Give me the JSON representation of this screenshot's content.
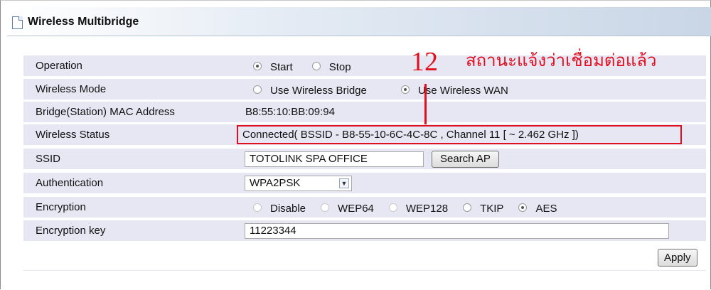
{
  "panel": {
    "title": "Wireless Multibridge"
  },
  "rows": {
    "operation": {
      "label": "Operation",
      "options": [
        "Start",
        "Stop"
      ],
      "selected": "Start"
    },
    "wireless_mode": {
      "label": "Wireless Mode",
      "options": [
        "Use Wireless Bridge",
        "Use Wireless WAN"
      ],
      "selected": "Use Wireless WAN"
    },
    "mac": {
      "label": "Bridge(Station) MAC Address",
      "value": "B8:55:10:BB:09:94"
    },
    "status": {
      "label": "Wireless Status",
      "value": "Connected( BSSID - B8-55-10-6C-4C-8C , Channel 11 [ ~ 2.462 GHz ])"
    },
    "ssid": {
      "label": "SSID",
      "value": "TOTOLINK SPA OFFICE",
      "button": "Search AP"
    },
    "authentication": {
      "label": "Authentication",
      "value": "WPA2PSK"
    },
    "encryption": {
      "label": "Encryption",
      "options": [
        "Disable",
        "WEP64",
        "WEP128",
        "TKIP",
        "AES"
      ],
      "selected": "AES"
    },
    "key": {
      "label": "Encryption key",
      "value": "11223344"
    }
  },
  "apply_label": "Apply",
  "annotation": {
    "number": "12",
    "text": "สถานะแจ้งว่าเชื่อมต่อแล้ว",
    "color": "#e01020"
  }
}
